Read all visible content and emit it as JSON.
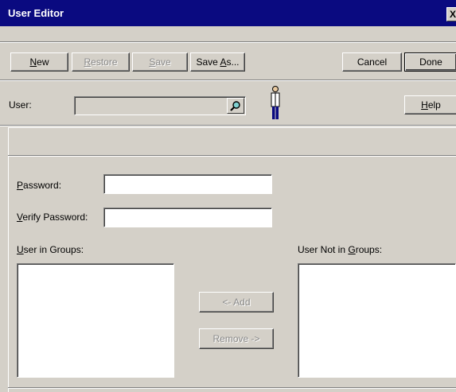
{
  "window": {
    "title": "User Editor",
    "close_glyph": "X"
  },
  "toolbar": {
    "new": {
      "prefix": "",
      "mnemonic": "N",
      "suffix": "ew"
    },
    "restore": {
      "prefix": "",
      "mnemonic": "R",
      "suffix": "estore"
    },
    "save": {
      "prefix": "",
      "mnemonic": "S",
      "suffix": "ave"
    },
    "save_as": {
      "prefix": "Save ",
      "mnemonic": "A",
      "suffix": "s..."
    },
    "cancel": "Cancel",
    "done": "Done"
  },
  "user_row": {
    "label": "User:",
    "value": "",
    "search_icon": "magnifier-icon",
    "person_icon": "person-icon",
    "help": {
      "prefix": "",
      "mnemonic": "H",
      "suffix": "elp"
    }
  },
  "form": {
    "password": {
      "mnemonic": "P",
      "rest": "assword:",
      "value": ""
    },
    "verify_password": {
      "mnemonic": "V",
      "rest": "erify Password:",
      "value": ""
    }
  },
  "groups": {
    "in_label": {
      "mnemonic": "U",
      "rest": "ser in Groups:"
    },
    "not_in_label": {
      "prefix": "User Not in ",
      "mnemonic": "G",
      "rest": "roups:"
    },
    "in_items": [],
    "not_in_items": [],
    "add_button": "<- Add",
    "remove_button": "Remove ->"
  },
  "colors": {
    "titlebar": "#0a0a80",
    "face": "#d4d0c8",
    "disabled_text": "#8a8a8a"
  }
}
